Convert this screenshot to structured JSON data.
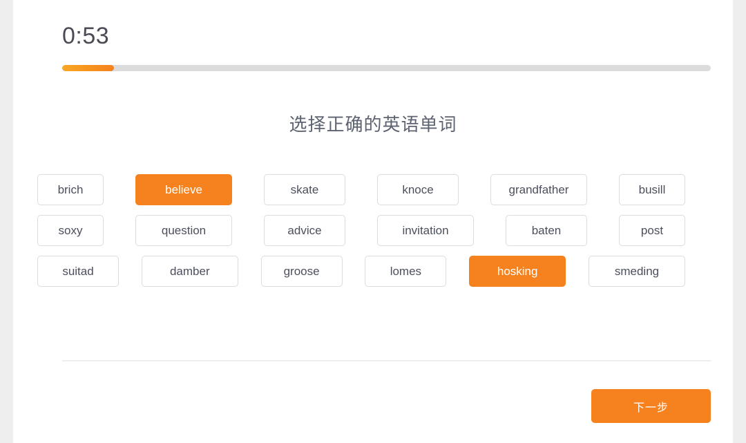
{
  "timer": {
    "label": "0:53"
  },
  "progress": {
    "percent": 8,
    "fill_color": "#f5821f",
    "track_color": "#dcdcdc"
  },
  "question": {
    "title": "选择正确的英语单词"
  },
  "theme": {
    "accent": "#f5821f",
    "card_bg": "#ffffff",
    "page_bg": "#eeeeee",
    "chip_border": "#dcdcdc",
    "text": "#4b4f5c"
  },
  "word_rows": [
    [
      {
        "label": "brich",
        "selected": false,
        "size": "w-sm"
      },
      {
        "label": "believe",
        "selected": true,
        "size": "w-lg"
      },
      {
        "label": "skate",
        "selected": false,
        "size": "w-md"
      },
      {
        "label": "knoce",
        "selected": false,
        "size": "w-md"
      },
      {
        "label": "grandfather",
        "selected": false,
        "size": "w-lg"
      },
      {
        "label": "busill",
        "selected": false,
        "size": "w-sm"
      }
    ],
    [
      {
        "label": "soxy",
        "selected": false,
        "size": "w-sm"
      },
      {
        "label": "question",
        "selected": false,
        "size": "w-lg"
      },
      {
        "label": "advice",
        "selected": false,
        "size": "w-md"
      },
      {
        "label": "invitation",
        "selected": false,
        "size": "w-lg"
      },
      {
        "label": "baten",
        "selected": false,
        "size": "w-md"
      },
      {
        "label": "post",
        "selected": false,
        "size": "w-sm"
      }
    ],
    [
      {
        "label": "suitad",
        "selected": false,
        "size": "w-md"
      },
      {
        "label": "damber",
        "selected": false,
        "size": "w-lg"
      },
      {
        "label": "groose",
        "selected": false,
        "size": "w-md"
      },
      {
        "label": "lomes",
        "selected": false,
        "size": "w-md"
      },
      {
        "label": "hosking",
        "selected": true,
        "size": "w-lg"
      },
      {
        "label": "smeding",
        "selected": false,
        "size": "w-lg"
      }
    ]
  ],
  "footer": {
    "next_label": "下一步"
  }
}
